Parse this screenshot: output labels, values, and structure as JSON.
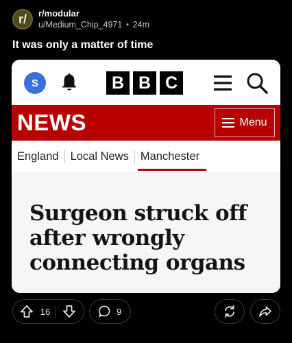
{
  "post": {
    "subreddit_icon_letter": "r/",
    "subreddit": "r/modular",
    "author": "u/Medium_Chip_4971",
    "separator": "•",
    "age": "24m",
    "title": "It was only a matter of time"
  },
  "card": {
    "account_initial": "S",
    "logo_letters": [
      "B",
      "B",
      "C"
    ],
    "section_title": "NEWS",
    "menu_label": "Menu",
    "nav": [
      "England",
      "Local News",
      "Manchester"
    ],
    "active_nav": "Manchester",
    "headline": "Surgeon struck off after wrongly connecting organs",
    "colors": {
      "brand_red": "#b80000",
      "account_blue": "#3b6fd9"
    }
  },
  "actions": {
    "upvotes": "16",
    "comments": "9",
    "icons": [
      "upvote-icon",
      "downvote-icon",
      "comment-icon",
      "repost-icon",
      "share-icon"
    ]
  }
}
